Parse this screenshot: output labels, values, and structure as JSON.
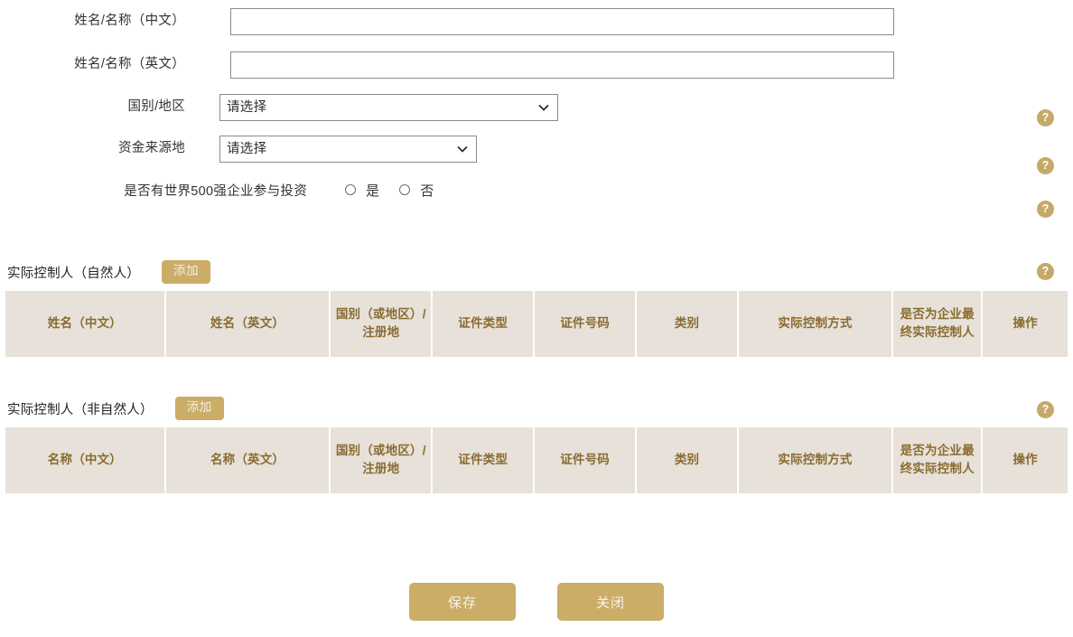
{
  "form": {
    "fields": [
      {
        "label": "姓名/名称（中文）",
        "type": "text",
        "value": "",
        "placeholder": "",
        "has_help": false
      },
      {
        "label": "姓名/名称（英文）",
        "type": "text",
        "value": "",
        "placeholder": "",
        "has_help": false
      },
      {
        "label": "国别/地区",
        "type": "select",
        "value": "请选择",
        "has_help": true
      },
      {
        "label": "资金来源地",
        "type": "select",
        "value": "请选择",
        "has_help": true
      }
    ],
    "radio_row": {
      "label": "是否有世界500强企业参与投资",
      "options": [
        {
          "label": "是",
          "checked": false
        },
        {
          "label": "否",
          "checked": false
        }
      ],
      "has_help": true
    }
  },
  "help_icon": {
    "glyph": "?",
    "name": "help-question-icon",
    "color": "#c6a969"
  },
  "sections": [
    {
      "title": "实际控制人（自然人）",
      "add_label": "添加",
      "columns": [
        "姓名（中文）",
        "姓名（英文）",
        "国别（或地区）/注册地",
        "证件类型",
        "证件号码",
        "类别",
        "实际控制方式",
        "是否为企业最终实际控制人",
        "操作"
      ],
      "rows": []
    },
    {
      "title": "实际控制人（非自然人）",
      "add_label": "添加",
      "columns": [
        "名称（中文）",
        "名称（英文）",
        "国别（或地区）/注册地",
        "证件类型",
        "证件号码",
        "类别",
        "实际控制方式",
        "是否为企业最终实际控制人",
        "操作"
      ],
      "rows": []
    }
  ],
  "footer": {
    "save_label": "保存",
    "close_label": "关闭"
  },
  "colors": {
    "accent": "#cbad67",
    "table_header_bg": "#e7e1d9",
    "table_header_text": "#8a6b31",
    "help_badge": "#c6a969"
  }
}
